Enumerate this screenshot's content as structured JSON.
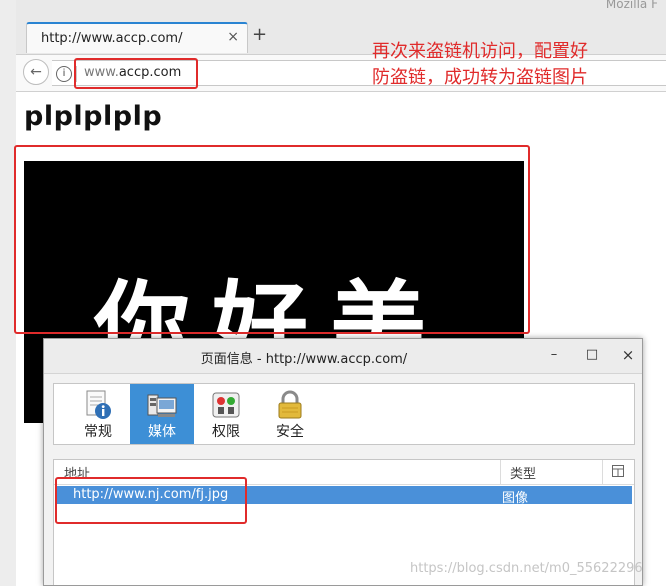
{
  "browser": {
    "window_title": "Mozilla F",
    "tab": {
      "title": "http://www.accp.com/",
      "close": "×"
    },
    "new_tab": "+",
    "back": "←",
    "info": "i",
    "url_prefix": "www.",
    "url_domain": "accp.com"
  },
  "page": {
    "heading": "plplplplp",
    "image_text": "你好美"
  },
  "annotation": {
    "text": "再次来盗链机访问，配置好防盗链，成功转为盗链图片",
    "color": "#e02b2b"
  },
  "dialog": {
    "title": "页面信息 - http://www.accp.com/",
    "controls": {
      "minimize": "–",
      "maximize": "□",
      "close": "×"
    },
    "tabs": [
      {
        "label": "常规",
        "icon": "general-info-icon",
        "active": false
      },
      {
        "label": "媒体",
        "icon": "media-icon",
        "active": true
      },
      {
        "label": "权限",
        "icon": "permissions-icon",
        "active": false
      },
      {
        "label": "安全",
        "icon": "lock-icon",
        "active": false
      }
    ],
    "columns": {
      "address": "地址",
      "type": "类型"
    },
    "rows": [
      {
        "address": "http://www.nj.com/fj.jpg",
        "type": "图像",
        "selected": true
      }
    ]
  },
  "watermark": "https://blog.csdn.net/m0_55622296",
  "colors": {
    "accent": "#3d8fd6",
    "selection": "#4a90d9",
    "annotation_red": "#e02b2b"
  }
}
